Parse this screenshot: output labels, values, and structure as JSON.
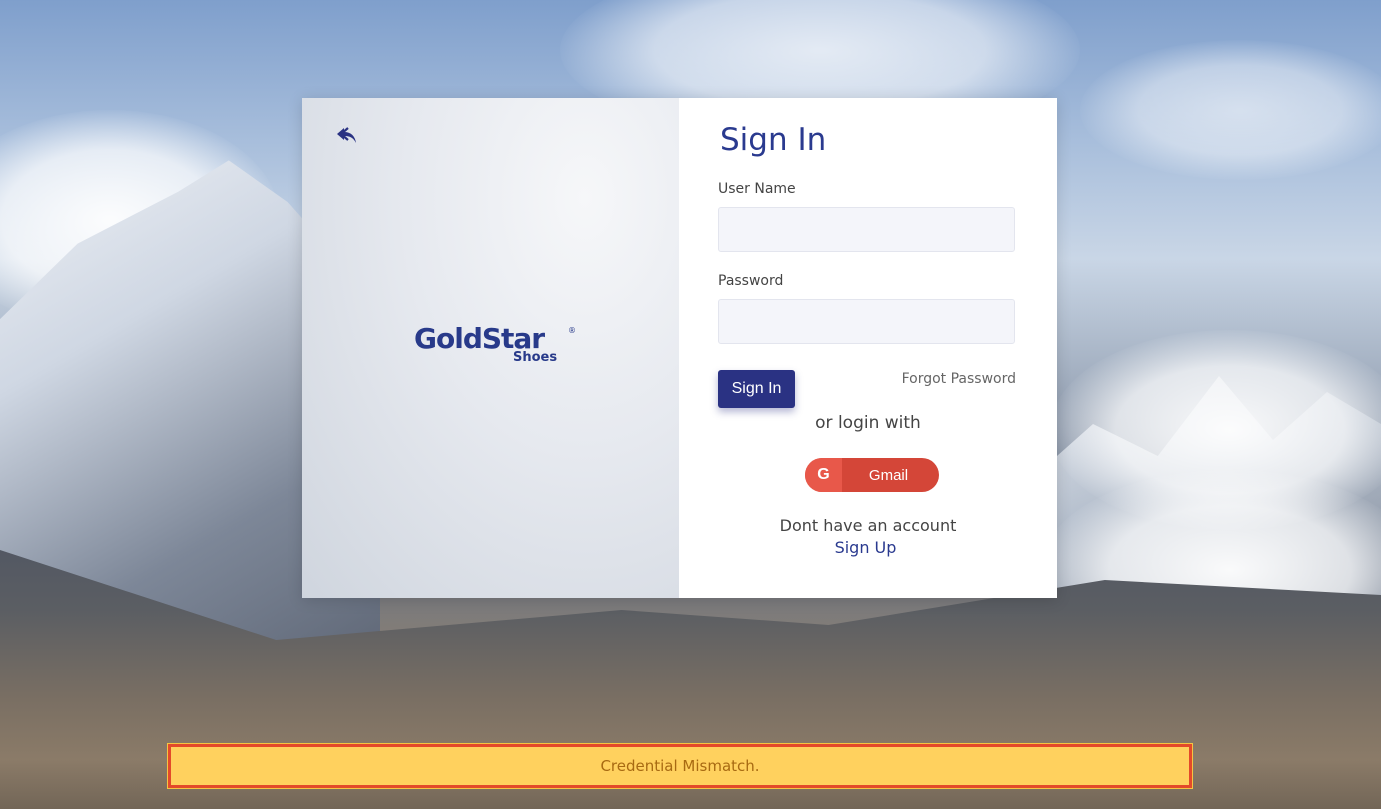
{
  "login_card": {
    "logo": {
      "brand": "GoldStar",
      "sub": "Shoes",
      "registered": "®"
    },
    "form": {
      "title": "Sign In",
      "username_label": "User Name",
      "username_value": "",
      "password_label": "Password",
      "password_value": "",
      "signin_label": "Sign In",
      "forgot_label": "Forgot Password",
      "or_text": "or login with",
      "gmail_label": "Gmail",
      "gmail_icon": "G",
      "no_account_text": "Dont have an account",
      "signup_label": "Sign Up"
    }
  },
  "alert": {
    "message": "Credential Mismatch."
  },
  "colors": {
    "brand": "#2a3283",
    "title": "#2a3a8f",
    "gmail": "#d44638",
    "alert_bg": "#ffd15e",
    "alert_border": "#e34a2a",
    "alert_text": "#a86a12"
  },
  "icons": {
    "back": "reply-arrow-icon",
    "google": "google-g-icon"
  }
}
